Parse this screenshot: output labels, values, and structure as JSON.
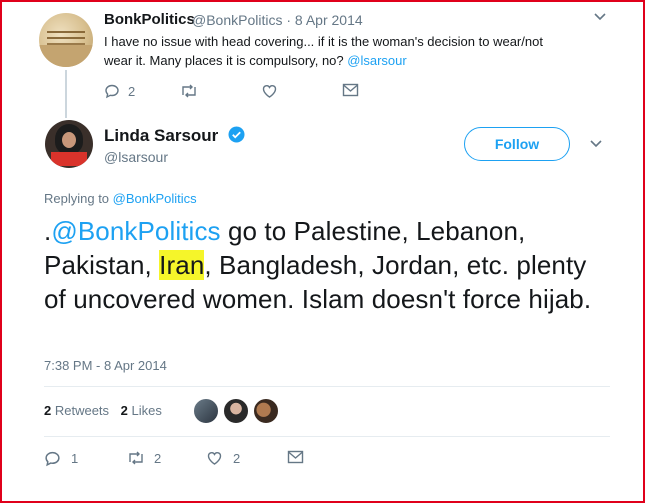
{
  "parent_tweet": {
    "name": "BonkPolitics",
    "handle": "@BonkPolitics",
    "date": "· 8 Apr 2014",
    "text": "I have no issue with head covering... if it is the woman's decision to wear/not wear it.  Many places it is compulsory, no? ",
    "mention": "@lsarsour",
    "replies": "2",
    "retweets": "",
    "likes": ""
  },
  "main_tweet": {
    "name": "Linda Sarsour",
    "handle": "@lsarsour",
    "follow_label": "Follow",
    "replying_prefix": "Replying to ",
    "replying_to": "@BonkPolitics",
    "text_prefix": ".",
    "text_mention": "@BonkPolitics",
    "text_part1": " go to Palestine, Lebanon, Pakistan, ",
    "text_highlight": "Iran",
    "text_part2": ", Bangladesh, Jordan, etc. plenty of uncovered women. Islam doesn't force hijab.",
    "timestamp": "7:38 PM - 8 Apr 2014",
    "retweet_count": "2",
    "retweet_label": " Retweets",
    "like_count": "2",
    "like_label": " Likes",
    "replies": "1",
    "retweets": "2",
    "likes": "2"
  },
  "colors": {
    "accent": "#1da1f2",
    "muted": "#657786",
    "highlight": "#f5f52a",
    "border": "#e0001b"
  }
}
